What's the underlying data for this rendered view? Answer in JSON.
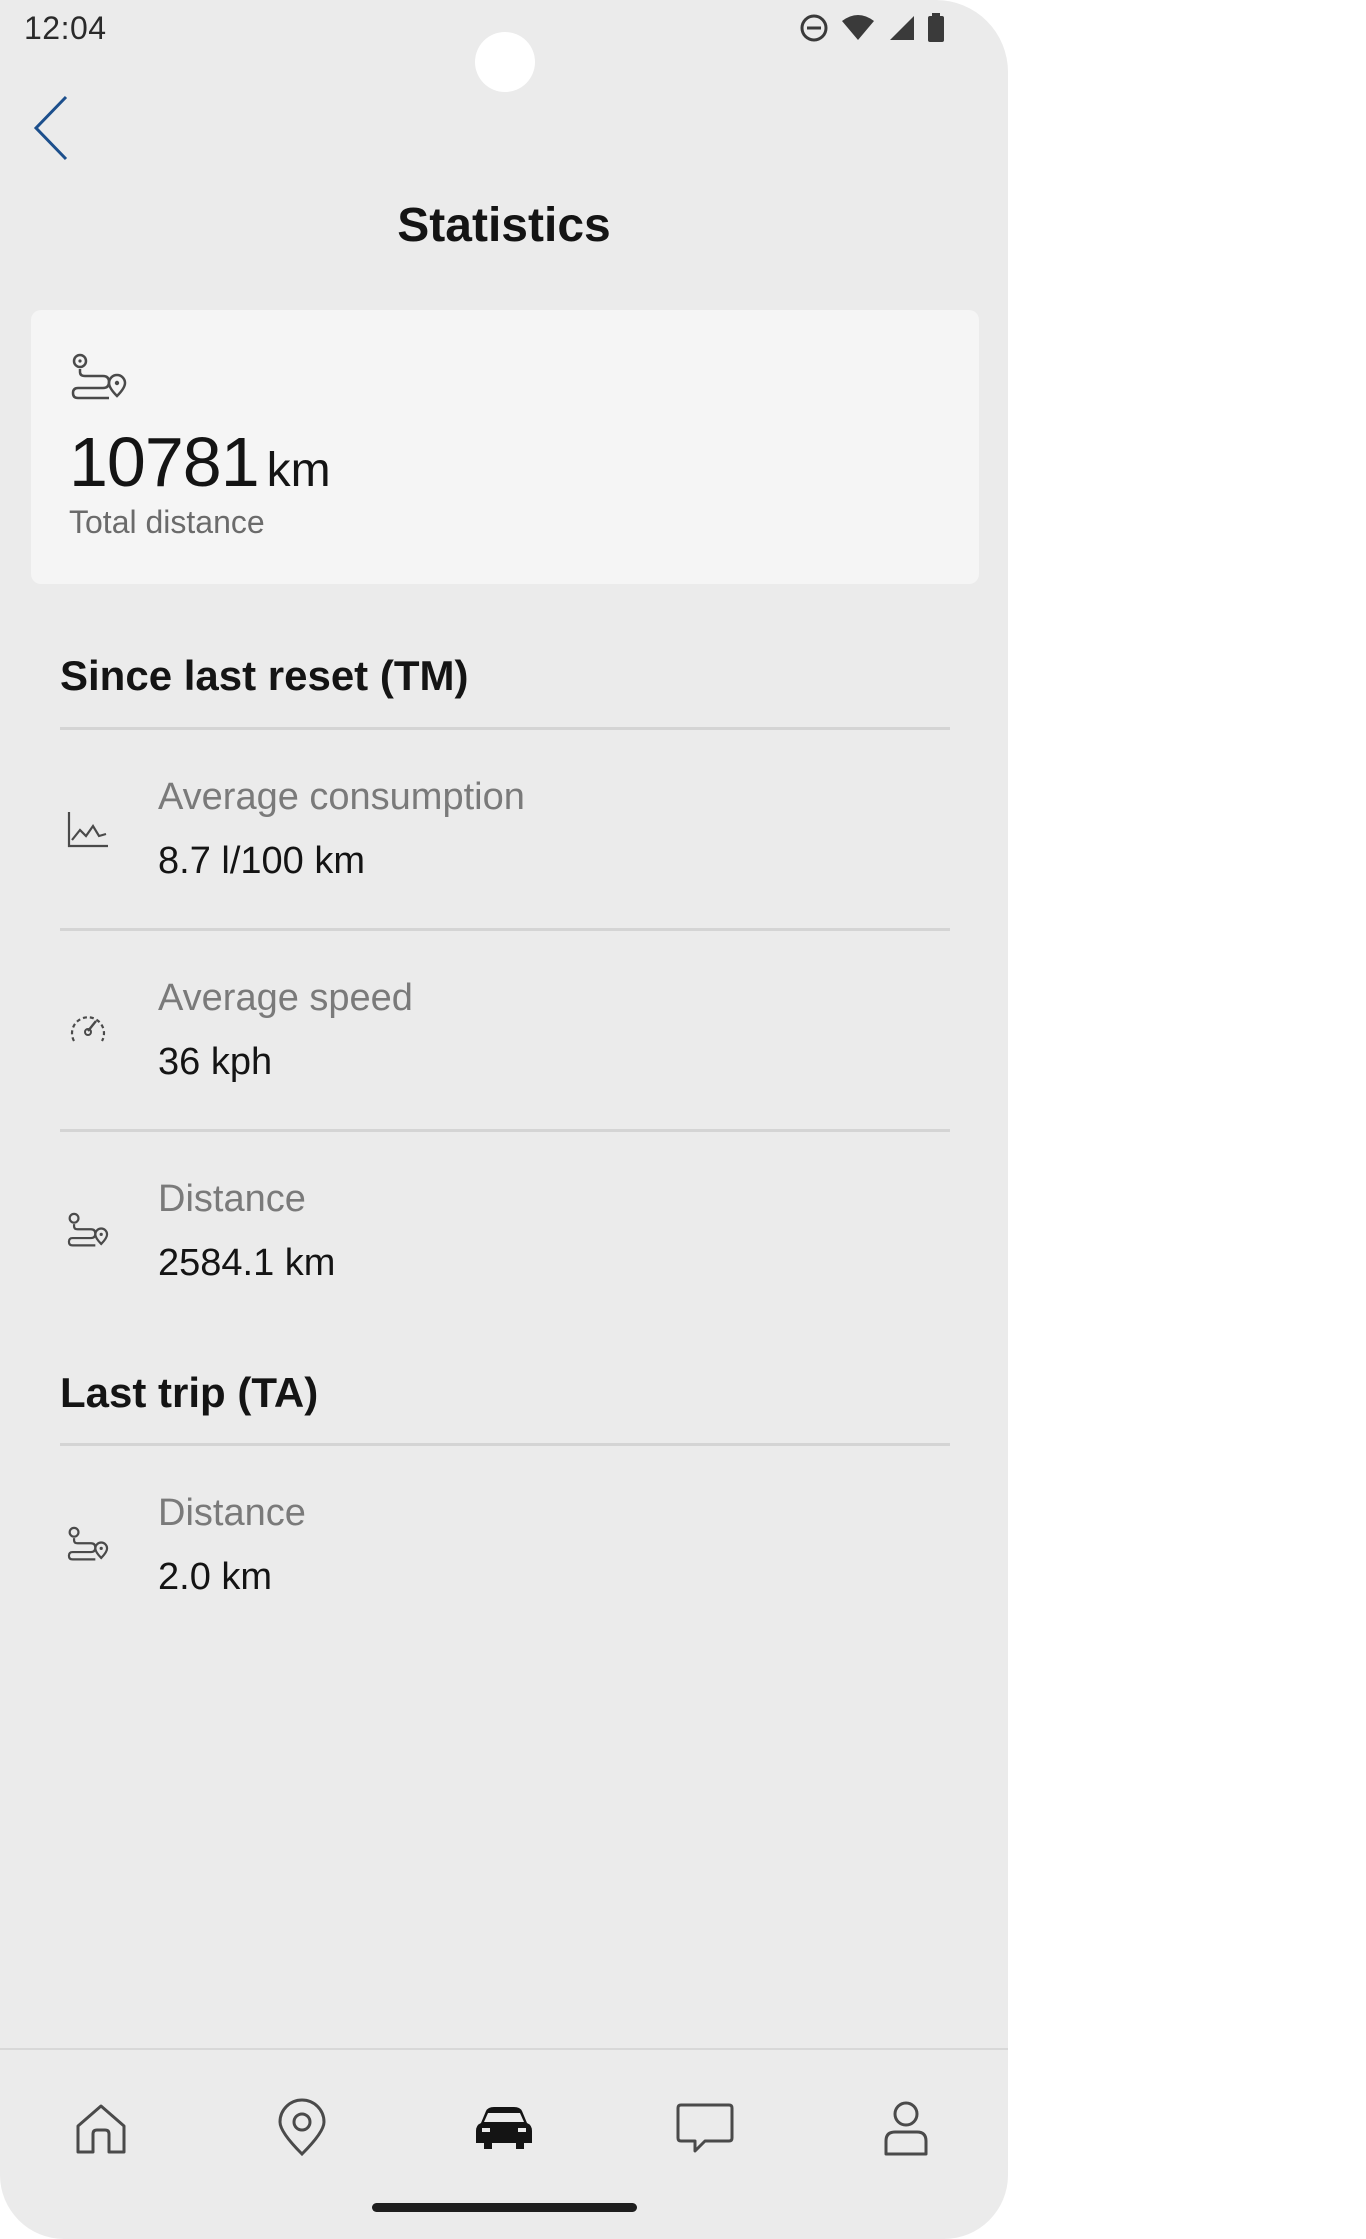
{
  "status_bar": {
    "time": "12:04",
    "icons": [
      "do-not-disturb-icon",
      "wifi-icon",
      "signal-icon",
      "battery-icon"
    ]
  },
  "header": {
    "title": "Statistics",
    "back_icon": "chevron-left-icon"
  },
  "total": {
    "icon": "route-icon",
    "value": "10781",
    "unit": "km",
    "label": "Total distance"
  },
  "sections": [
    {
      "heading": "Since last reset (TM)",
      "rows": [
        {
          "icon": "chart-line-icon",
          "label": "Average consumption",
          "value": "8.7 l/100 km"
        },
        {
          "icon": "speedometer-icon",
          "label": "Average speed",
          "value": "36 kph"
        },
        {
          "icon": "route-icon",
          "label": "Distance",
          "value": "2584.1 km"
        }
      ]
    },
    {
      "heading": "Last trip (TA)",
      "rows": [
        {
          "icon": "route-icon",
          "label": "Distance",
          "value": "2.0 km"
        }
      ]
    }
  ],
  "bottom_nav": {
    "items": [
      {
        "icon": "home-icon",
        "active": false
      },
      {
        "icon": "map-pin-icon",
        "active": false
      },
      {
        "icon": "car-icon",
        "active": true
      },
      {
        "icon": "chat-bubble-icon",
        "active": false
      },
      {
        "icon": "profile-icon",
        "active": false
      }
    ]
  },
  "colors": {
    "background": "#ebebeb",
    "card": "#f5f5f5",
    "accent": "#1c4f8c",
    "text_primary": "#141414",
    "text_secondary": "#7a7a7a",
    "divider": "#d4d4d4"
  }
}
